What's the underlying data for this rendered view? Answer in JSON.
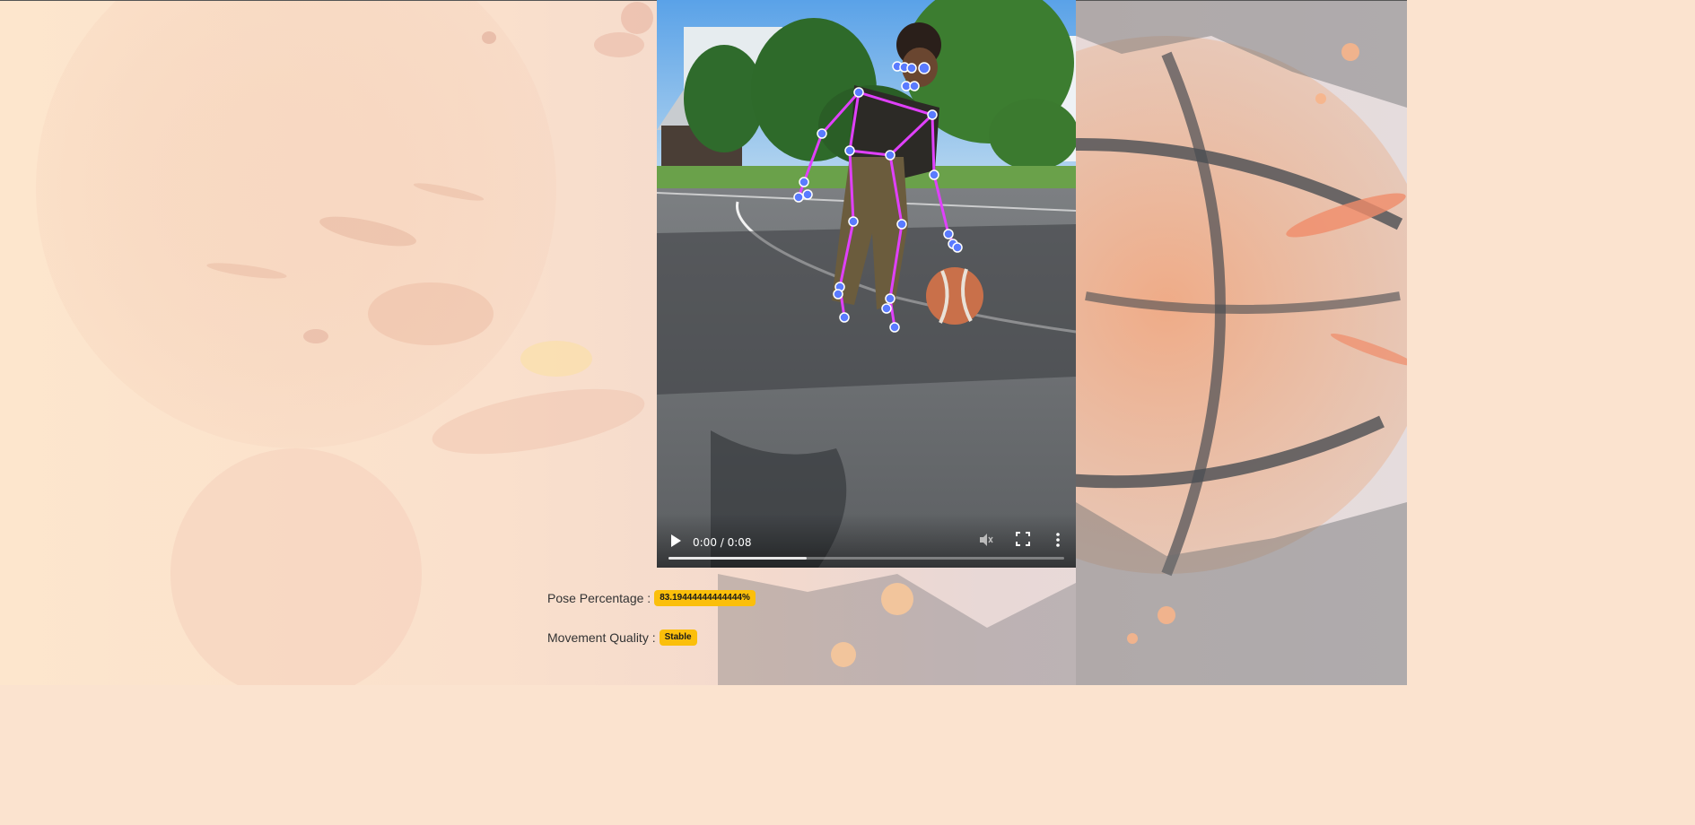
{
  "video": {
    "time": "0:00 / 0:08",
    "progress": 0.35
  },
  "stats": {
    "pose_label": "Pose Percentage :",
    "pose_value": "83.19444444444444%",
    "movement_label": "Movement Quality :",
    "movement_value": "Stable"
  },
  "icons": {
    "play": "play-icon",
    "mute": "volume-muted-icon",
    "fullscreen": "fullscreen-icon",
    "more": "more-options-icon"
  },
  "colors": {
    "badge": "#fbbf0b",
    "skeleton": "#e040fb",
    "keypoint": "#4b6cff"
  }
}
